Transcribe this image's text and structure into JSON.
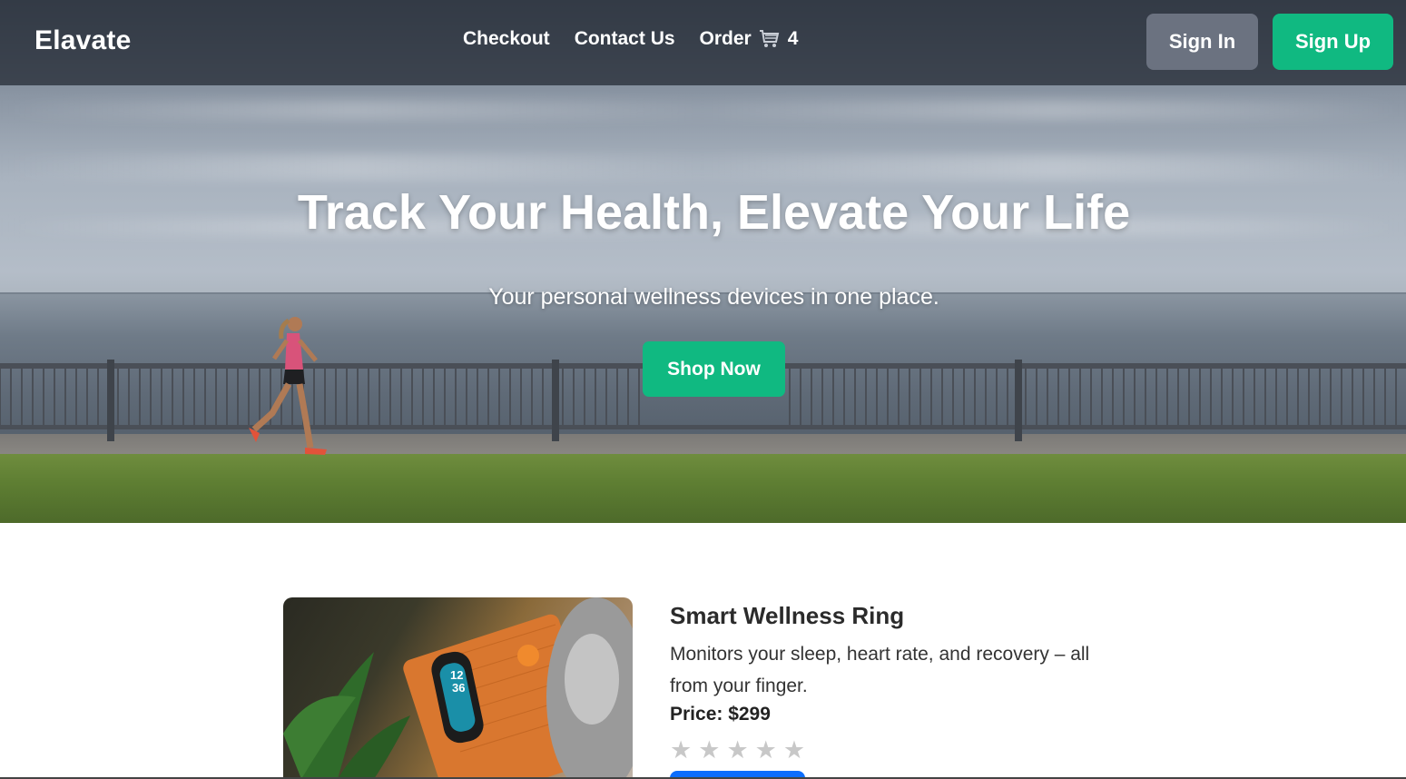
{
  "brand": "Elavate",
  "nav": {
    "links": [
      {
        "label": "Checkout"
      },
      {
        "label": "Contact Us"
      },
      {
        "label": "Order",
        "icon": "cart-icon",
        "count": "4"
      }
    ],
    "signin_label": "Sign In",
    "signup_label": "Sign Up"
  },
  "hero": {
    "title": "Track Your Health, Elevate Your Life",
    "subtitle": "Your personal wellness devices in one place.",
    "cta_label": "Shop Now"
  },
  "product": {
    "name": "Smart Wellness Ring",
    "description": "Monitors your sleep, heart rate, and recovery – all from your finger.",
    "price": "Price: $299",
    "rating": 0,
    "rating_max": 5
  },
  "colors": {
    "accent": "#10b981",
    "secondary": "#6b7280",
    "primary_blue": "#0d6efd",
    "navbar": "#282e38"
  }
}
